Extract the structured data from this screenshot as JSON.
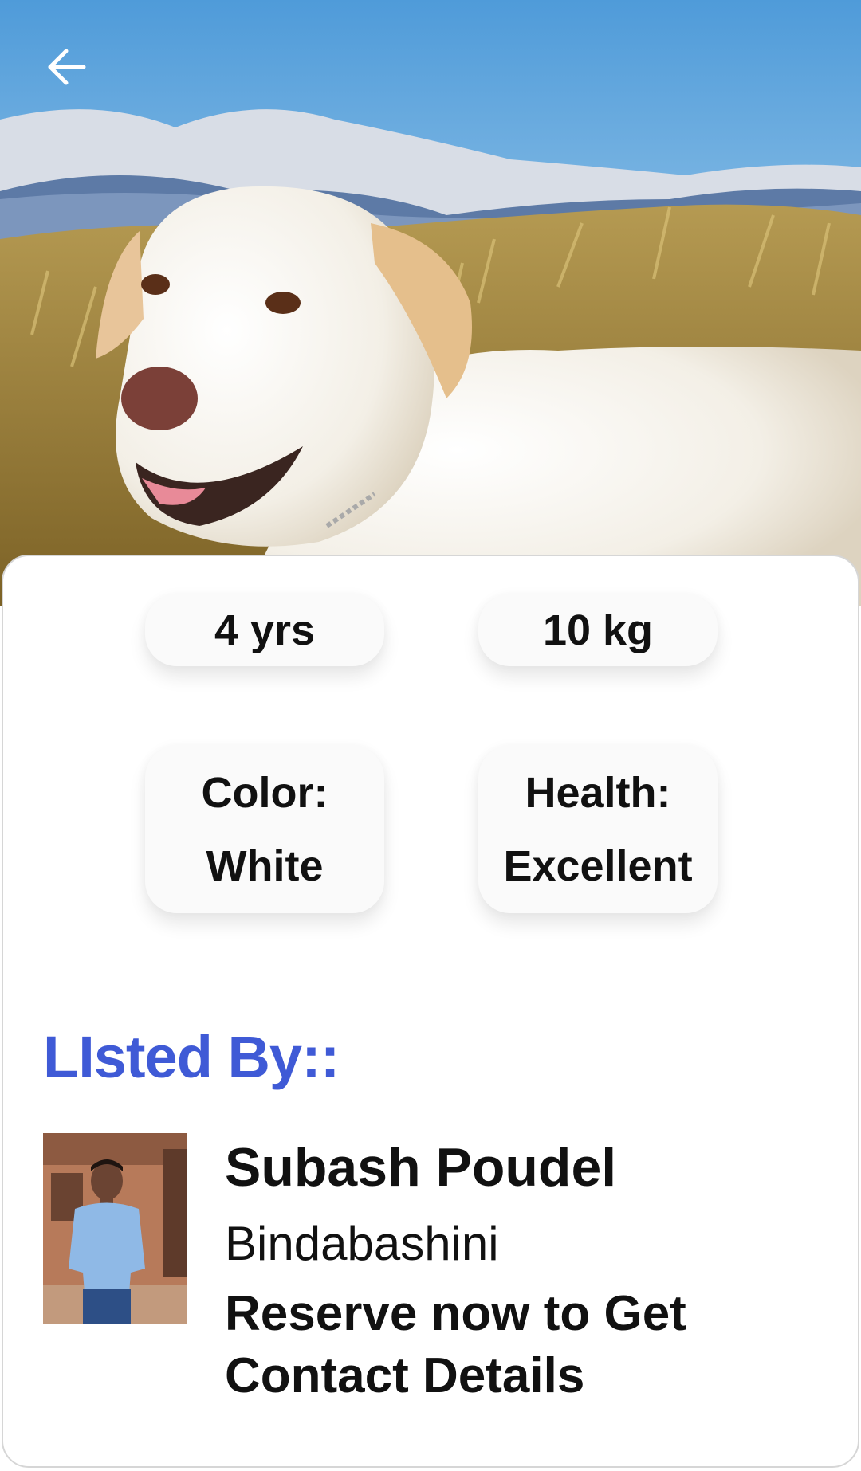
{
  "header": {
    "back_icon": "arrow-left-icon",
    "photo_subject": "dog-photo"
  },
  "pet": {
    "age": "4 yrs",
    "weight": "10 kg",
    "color_label": "Color:",
    "color_value": "White",
    "health_label": "Health:",
    "health_value": "Excellent"
  },
  "listing": {
    "heading": "LIsted By::",
    "heading_color": "#3f5ad6",
    "owner_name": "Subash Poudel",
    "owner_location": "Bindabashini",
    "reserve_note": "Reserve now to Get Contact Details"
  }
}
